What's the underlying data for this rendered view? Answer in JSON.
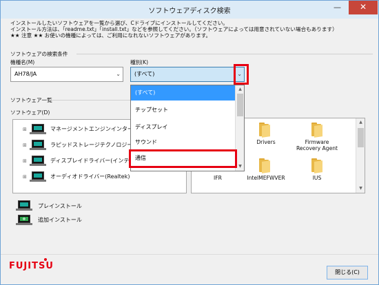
{
  "window": {
    "title": "ソフトウェアディスク検索",
    "minimize_glyph": "—",
    "close_glyph": "✕"
  },
  "description": {
    "line1": "インストールしたいソフトウェアを一覧から選び、Cドライブにインストールしてください。",
    "line2": "インストール方法は、「readme.txt」「install.txt」などを参照してください。（ソフトウェアによっては用意されていない場合もあります）",
    "line3": "★★ 注意 ★★ お使いの機種によっては、ご利用になれないソフトウェアがあります。"
  },
  "search": {
    "section_label": "ソフトウェアの検索条件",
    "model_label": "機種名(M)",
    "model_value": "AH78/JA",
    "type_label": "種別(K)",
    "type_value": "(すべて)",
    "type_options": [
      "(すべて)",
      "チップセット",
      "ディスプレイ",
      "サウンド",
      "通信"
    ],
    "type_selected_index": 0,
    "dropdown_scroll_fraction": 0.33
  },
  "software_list": {
    "section_label": "ソフトウェア一覧",
    "tree_label": "ソフトウェア(D)",
    "items": [
      "マネージメントエンジンインターフ",
      "ラピッドストレージテクノロジー(I",
      "ディスプレイドライバー(インテル",
      "オーディオドライバー(Realtek)"
    ]
  },
  "folders": {
    "row1": [
      "Drivers",
      "Firmware\nRecovery Agent"
    ],
    "row2": [
      "IFR",
      "IntelMEFWVER",
      "IUS"
    ]
  },
  "legend": {
    "preinstall_label": "プレインストール",
    "additional_label": "追加インストール"
  },
  "footer": {
    "brand": "FUJITSU",
    "close_button": "閉じる(C)"
  },
  "colors": {
    "highlight_red": "#e60012",
    "selection_blue": "#3399ff",
    "folder_yellow": "#f7d57b",
    "pc_teal": "#1aa89c"
  }
}
